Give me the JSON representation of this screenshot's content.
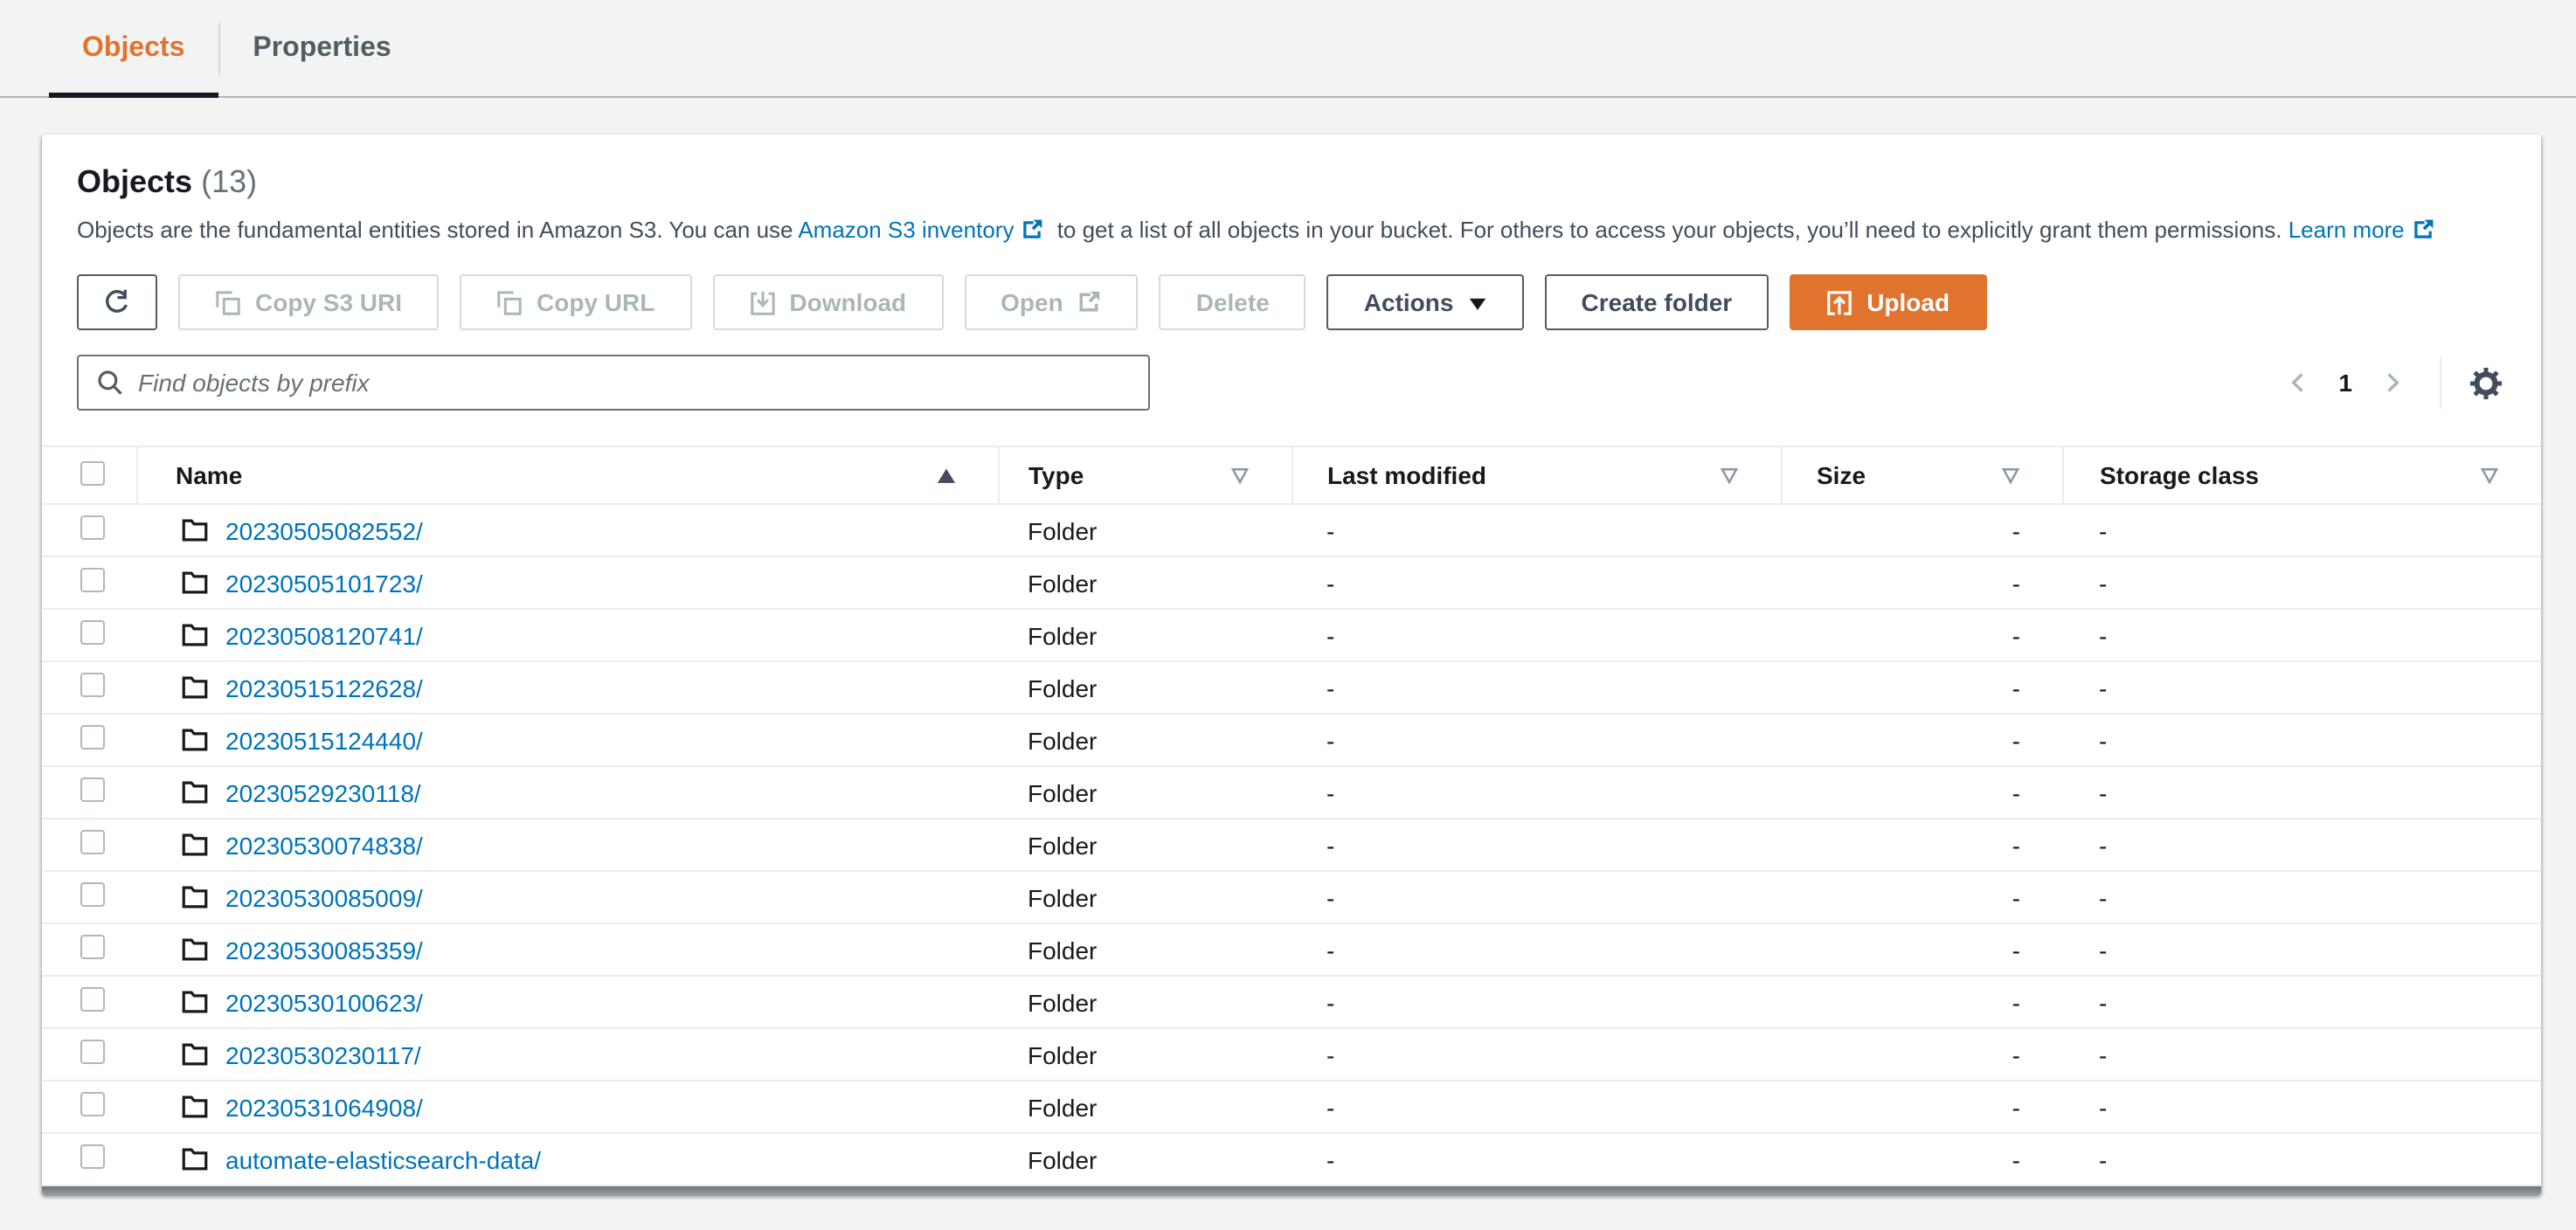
{
  "tabs": [
    {
      "label": "Objects",
      "active": true
    },
    {
      "label": "Properties",
      "active": false
    }
  ],
  "panel": {
    "title": "Objects",
    "count": "(13)",
    "description": {
      "part1": "Objects are the fundamental entities stored in Amazon S3. You can use ",
      "link1": "Amazon S3 inventory",
      "part2": " to get a list of all objects in your bucket. For others to access your objects, you’ll need to explicitly grant them permissions. ",
      "link2": "Learn more"
    },
    "toolbar": {
      "copy_s3_uri": "Copy S3 URI",
      "copy_url": "Copy URL",
      "download": "Download",
      "open": "Open",
      "delete": "Delete",
      "actions": "Actions",
      "create_folder": "Create folder",
      "upload": "Upload"
    },
    "search": {
      "placeholder": "Find objects by prefix"
    },
    "pagination": {
      "page": "1"
    },
    "table": {
      "columns": [
        "Name",
        "Type",
        "Last modified",
        "Size",
        "Storage class"
      ],
      "rows": [
        {
          "name": "20230505082552/",
          "type": "Folder",
          "last_modified": "-",
          "size": "-",
          "storage_class": "-"
        },
        {
          "name": "20230505101723/",
          "type": "Folder",
          "last_modified": "-",
          "size": "-",
          "storage_class": "-"
        },
        {
          "name": "20230508120741/",
          "type": "Folder",
          "last_modified": "-",
          "size": "-",
          "storage_class": "-"
        },
        {
          "name": "20230515122628/",
          "type": "Folder",
          "last_modified": "-",
          "size": "-",
          "storage_class": "-"
        },
        {
          "name": "20230515124440/",
          "type": "Folder",
          "last_modified": "-",
          "size": "-",
          "storage_class": "-"
        },
        {
          "name": "20230529230118/",
          "type": "Folder",
          "last_modified": "-",
          "size": "-",
          "storage_class": "-"
        },
        {
          "name": "20230530074838/",
          "type": "Folder",
          "last_modified": "-",
          "size": "-",
          "storage_class": "-"
        },
        {
          "name": "20230530085009/",
          "type": "Folder",
          "last_modified": "-",
          "size": "-",
          "storage_class": "-"
        },
        {
          "name": "20230530085359/",
          "type": "Folder",
          "last_modified": "-",
          "size": "-",
          "storage_class": "-"
        },
        {
          "name": "20230530100623/",
          "type": "Folder",
          "last_modified": "-",
          "size": "-",
          "storage_class": "-"
        },
        {
          "name": "20230530230117/",
          "type": "Folder",
          "last_modified": "-",
          "size": "-",
          "storage_class": "-"
        },
        {
          "name": "20230531064908/",
          "type": "Folder",
          "last_modified": "-",
          "size": "-",
          "storage_class": "-"
        },
        {
          "name": "automate-elasticsearch-data/",
          "type": "Folder",
          "last_modified": "-",
          "size": "-",
          "storage_class": "-"
        }
      ]
    }
  },
  "icons": {
    "refresh-icon": "circular-arrow",
    "copy-icon": "two-overlapping-squares",
    "download-icon": "box-with-down-arrow",
    "upload-icon": "box-with-up-arrow",
    "external-link-icon": "box-with-diagonal-arrow",
    "search-icon": "magnifier",
    "gear-icon": "settings-cog",
    "folder-icon": "folder-outline",
    "sort-ascending-icon": "filled-triangle-up",
    "filter-icon": "outline-triangle-down",
    "caret-down-icon": "filled-triangle-down",
    "chevron-left-icon": "angle-left",
    "chevron-right-icon": "angle-right"
  },
  "colors": {
    "page_background": "#f2f3f3",
    "panel_background": "#ffffff",
    "accent_orange": "#e0742e",
    "link_blue": "#0073bb",
    "text_dark": "#16191f",
    "text_secondary": "#414d5c",
    "disabled_gray": "#aab7b8",
    "border_light": "#eaeded"
  }
}
